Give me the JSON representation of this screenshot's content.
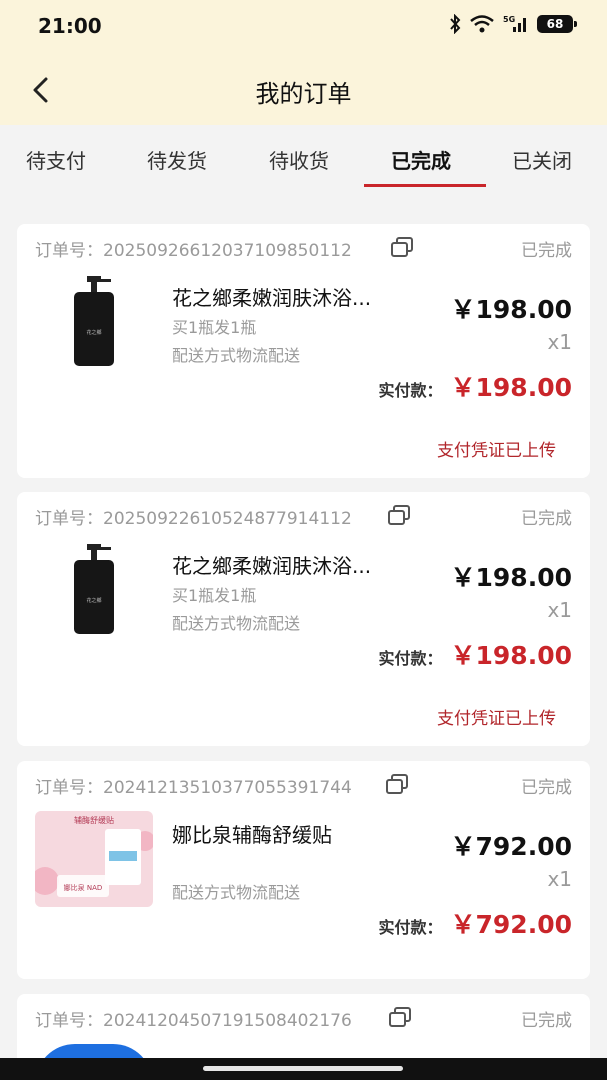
{
  "status_bar": {
    "time": "21:00",
    "network": "5G",
    "battery": "68"
  },
  "header": {
    "title": "我的订单"
  },
  "tabs": [
    {
      "label": "待支付"
    },
    {
      "label": "待发货"
    },
    {
      "label": "待收货"
    },
    {
      "label": "已完成",
      "active": true
    },
    {
      "label": "已关闭"
    }
  ],
  "orders": [
    {
      "order_no": "订单号：2025092661203710985011​2",
      "status": "已完成",
      "product_name": "花之鄉柔嫩润肤沐浴...",
      "spec": "买1瓶发1瓶",
      "shipping": "配送方式物流配送",
      "price": "￥198.00",
      "qty": "x1",
      "paid_label": "实付款：",
      "paid_amount": "￥198.00",
      "voucher_link": "支付凭证已上传",
      "thumb_text": "花之鄉"
    },
    {
      "order_no": "订单号：20250922610524877914112",
      "status": "已完成",
      "product_name": "花之鄉柔嫩润肤沐浴...",
      "spec": "买1瓶发1瓶",
      "shipping": "配送方式物流配送",
      "price": "￥198.00",
      "qty": "x1",
      "paid_label": "实付款：",
      "paid_amount": "￥198.00",
      "voucher_link": "支付凭证已上传",
      "thumb_text": "花之鄉"
    },
    {
      "order_no": "订单号：20241213510377055391744",
      "status": "已完成",
      "product_name": "娜比泉辅酶舒缓贴",
      "shipping": "配送方式物流配送",
      "price": "￥792.00",
      "qty": "x1",
      "paid_label": "实付款：",
      "paid_amount": "￥792.00",
      "thumb_text_top": "辅酶舒缓贴",
      "thumb_text_bottom": "娜比泉 NAD"
    },
    {
      "order_no": "订单号：20241204507191508402176",
      "status": "已完成"
    }
  ],
  "colors": {
    "header_bg": "#fbf4db",
    "accent_red": "#c9252a",
    "page_bg": "#f3f3f3"
  }
}
